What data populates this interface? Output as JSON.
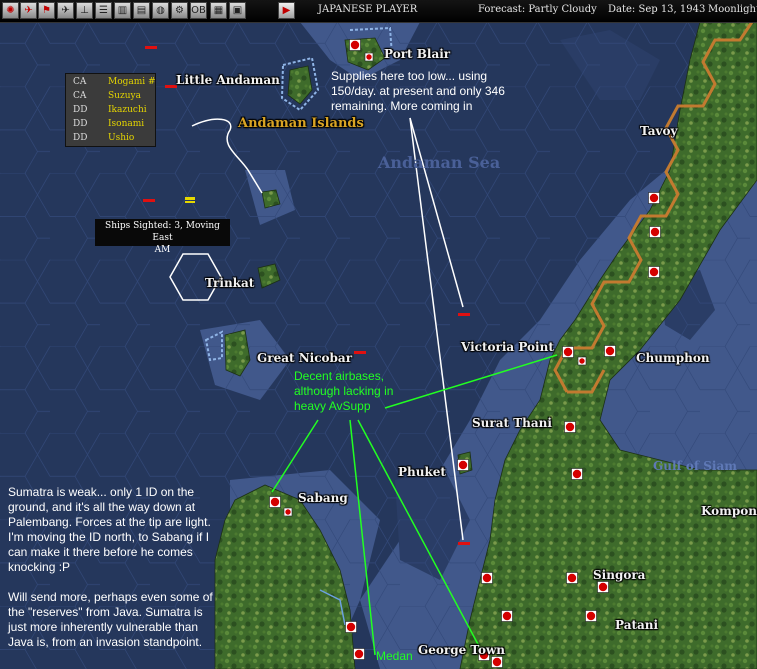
{
  "header": {
    "side": "JAPANESE PLAYER",
    "forecast": "Forecast: Partly Cloudy",
    "date": "Date: Sep 13, 1943",
    "moonlight": "Moonlight:"
  },
  "toolbar": {
    "buttons": [
      {
        "icon": "rising-sun-flag-icon",
        "glyph": "✺"
      },
      {
        "icon": "aircraft-icon",
        "glyph": "✈"
      },
      {
        "icon": "naval-flag-icon",
        "glyph": "⚑"
      },
      {
        "icon": "airbase-icon",
        "glyph": "✈"
      },
      {
        "icon": "ground-unit-icon",
        "glyph": "⊥"
      },
      {
        "icon": "unit-list-icon",
        "glyph": "☰"
      },
      {
        "icon": "production-icon",
        "glyph": "▥"
      },
      {
        "icon": "intel-chart-icon",
        "glyph": "▤"
      },
      {
        "icon": "globe-icon",
        "glyph": "◍"
      },
      {
        "icon": "settings-gear-icon",
        "glyph": "⚙"
      },
      {
        "icon": "orders-of-battle-icon",
        "glyph": "OB"
      },
      {
        "icon": "reports-icon",
        "glyph": "▦"
      },
      {
        "icon": "save-disk-icon",
        "glyph": "▣"
      },
      {
        "icon": "end-turn-play-icon",
        "glyph": "▶"
      }
    ]
  },
  "map": {
    "colors": {
      "ocean_deep": "#25375c",
      "ocean_shallow": "#40578a",
      "land": "#3d6a2c",
      "hex_border": "#b8732c",
      "base_red": "#d40000"
    },
    "labels": {
      "port_blair": "Port Blair",
      "little_andaman": "Little Andaman",
      "andaman_islands": "Andaman Islands",
      "andaman_sea": "Andaman Sea",
      "tavoy": "Tavoy",
      "trinkat": "Trinkat",
      "great_nicobar": "Great Nicobar",
      "victoria_point": "Victoria Point",
      "chumphon": "Chumphon",
      "surat_thani": "Surat Thani",
      "gulf_of_siam": "Gulf of Siam",
      "phuket": "Phuket",
      "sabang": "Sabang",
      "kompong": "Kompong",
      "singora": "Singora",
      "patani": "Patani",
      "george_town": "George Town"
    }
  },
  "task_force": {
    "ships": [
      {
        "cls": "CA",
        "name": "Mogami #"
      },
      {
        "cls": "CA",
        "name": "Suzuya"
      },
      {
        "cls": "DD",
        "name": "Ikazuchi"
      },
      {
        "cls": "DD",
        "name": "Isonami"
      },
      {
        "cls": "DD",
        "name": "Ushio"
      }
    ]
  },
  "sighting": {
    "line1": "Ships Sighted: 3, Moving East",
    "line2": "AM"
  },
  "annotations": {
    "supplies": "Supplies here too low... using\n150/day. at present and only 346\nremaining. More coming in",
    "airbases": "Decent airbases,\nalthough lacking in\nheavy AvSupp",
    "sumatra": "Sumatra is weak... only 1 ID on the\nground, and it's all the way down at\nPalembang. Forces at the tip are light.\nI'm moving the ID north, to Sabang if I\ncan make it there before he comes\nknocking :P\n\nWill send more, perhaps even some of\nthe \"reserves\" from Java. Sumatra is\njust more inherently vulnerable than\nJava is, from an invasion standpoint.",
    "medan": "Medan"
  }
}
